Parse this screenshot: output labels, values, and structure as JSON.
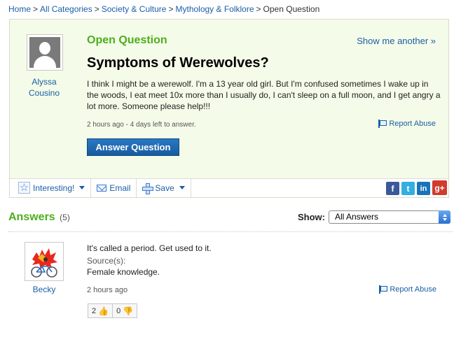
{
  "breadcrumb": {
    "home": "Home",
    "all_categories": "All Categories",
    "society": "Society & Culture",
    "mythology": "Mythology & Folklore",
    "current": "Open Question",
    "separator": ">"
  },
  "question": {
    "status": "Open Question",
    "show_another": "Show me another »",
    "title": "Symptoms of Werewolves?",
    "body": "I think I might be a werewolf. I'm a 13 year old girl. But I'm confused sometimes I wake up in the woods, I eat meet 10x more than I usually do, I can't sleep on a full moon, and I get angry a lot more. Someone please help!!!",
    "meta": "2 hours ago - 4 days left to answer.",
    "report": "Report Abuse",
    "answer_button": "Answer Question",
    "asker": "Alyssa Cousino"
  },
  "toolbar": {
    "interesting": "Interesting!",
    "email": "Email",
    "save": "Save",
    "social": {
      "facebook": "f",
      "twitter": "t",
      "linkedin": "in",
      "googleplus": "g+"
    }
  },
  "answers": {
    "title": "Answers",
    "count": "(5)",
    "show_label": "Show:",
    "filter_selected": "All Answers",
    "items": [
      {
        "author": "Becky",
        "text": "It's called a period. Get used to it.",
        "source_label": "Source(s):",
        "source": "Female knowledge.",
        "time": "2 hours ago",
        "report": "Report Abuse",
        "thumbs_up": "2",
        "thumbs_down": "0"
      }
    ]
  },
  "colors": {
    "link": "#1a5fa6",
    "green_heading": "#4caf1e",
    "question_bg": "#f4fbe8",
    "button_blue": "#1f6bb5"
  }
}
